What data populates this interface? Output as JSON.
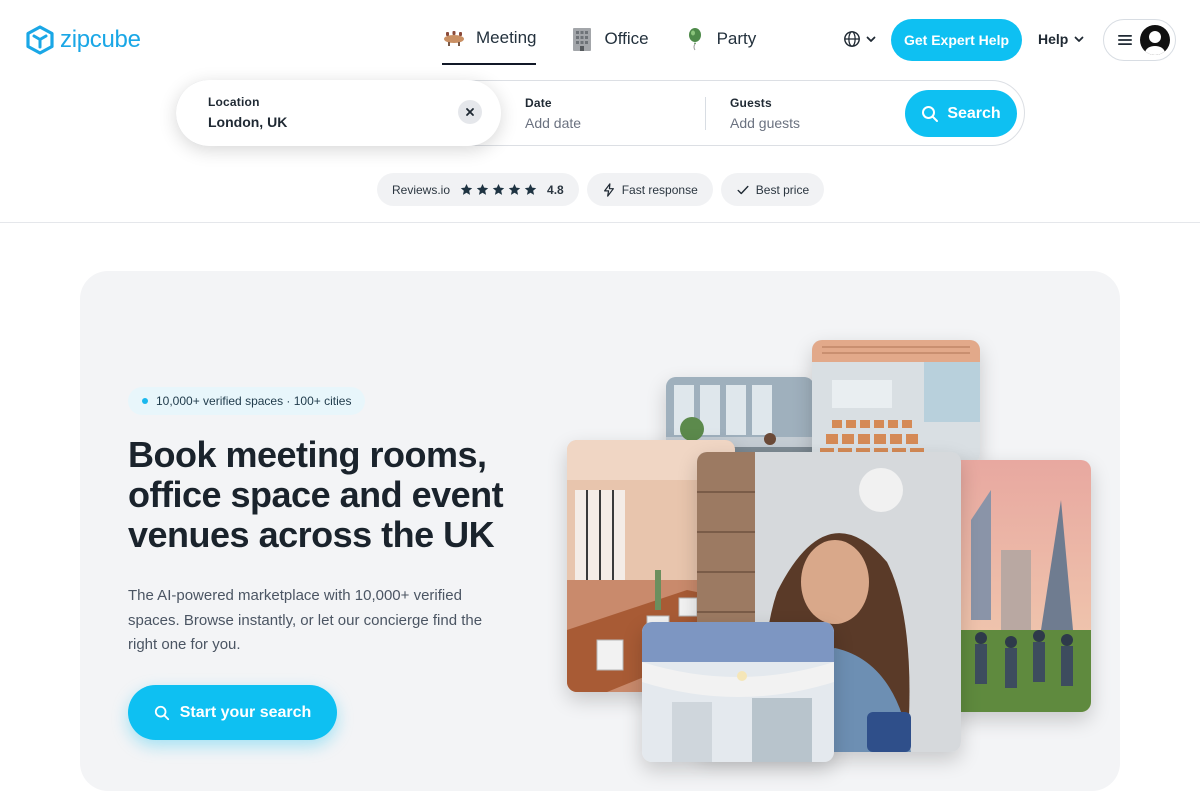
{
  "brand": {
    "name": "zipcube",
    "color": "#1aa7e6",
    "accent": "#0ec0f2"
  },
  "nav": {
    "tabs": [
      {
        "label": "Meeting",
        "icon": "meeting-table-icon",
        "active": true
      },
      {
        "label": "Office",
        "icon": "office-building-icon",
        "active": false
      },
      {
        "label": "Party",
        "icon": "party-balloon-icon",
        "active": false
      }
    ],
    "language_icon": "globe-icon",
    "expert_help_label": "Get Expert Help",
    "help_label": "Help"
  },
  "search": {
    "location": {
      "label": "Location",
      "value": "London, UK"
    },
    "date": {
      "label": "Date",
      "placeholder": "Add date"
    },
    "guests": {
      "label": "Guests",
      "placeholder": "Add guests"
    },
    "button_label": "Search"
  },
  "badges": {
    "reviews": {
      "label": "Reviews.io",
      "stars": 5,
      "rating": "4.8"
    },
    "fast_response": "Fast response",
    "best_price": "Best price"
  },
  "hero": {
    "pill": "10,000+ verified spaces · 100+ cities",
    "title": "Book meeting rooms, office space and event venues across the UK",
    "subtitle": "The AI-powered marketplace with 10,000+ verified spaces. Browse instantly, or let our concierge find the right one for you.",
    "cta_label": "Start your search"
  }
}
